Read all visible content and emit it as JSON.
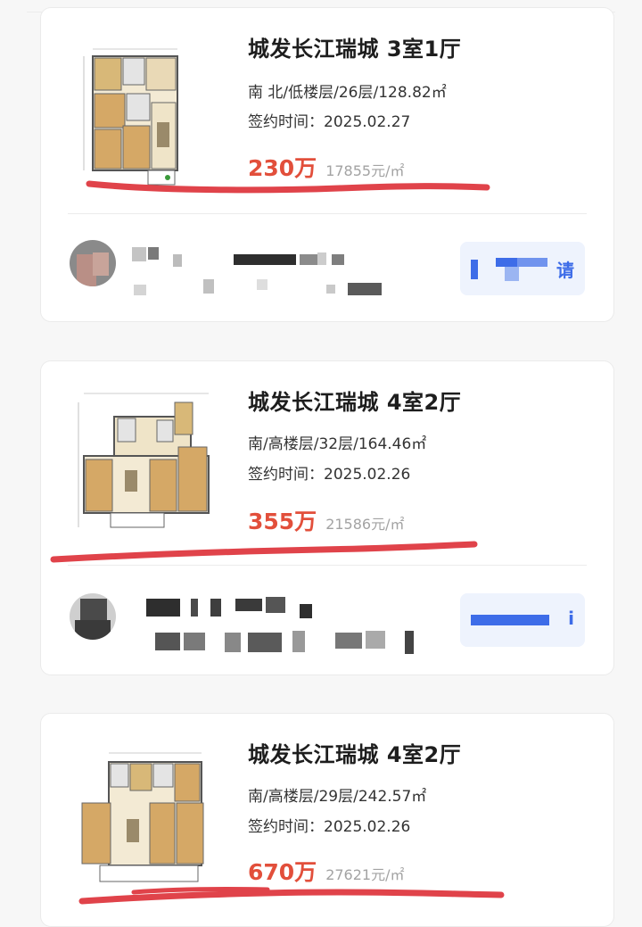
{
  "listings": [
    {
      "title": "城发长江瑞城 3室1厅",
      "details": "南 北/低楼层/26层/128.82㎡",
      "sign_label": "签约时间：",
      "sign_date": "2025.02.27",
      "price": "230万",
      "unit_price": "17855元/㎡",
      "contact_glyph": "请"
    },
    {
      "title": "城发长江瑞城 4室2厅",
      "details": "南/高楼层/32层/164.46㎡",
      "sign_label": "签约时间：",
      "sign_date": "2025.02.26",
      "price": "355万",
      "unit_price": "21586元/㎡",
      "contact_glyph": "i"
    },
    {
      "title": "城发长江瑞城 4室2厅",
      "details": "南/高楼层/29层/242.57㎡",
      "sign_label": "签约时间：",
      "sign_date": "2025.02.26",
      "price": "670万",
      "unit_price": "27621元/㎡"
    }
  ],
  "colors": {
    "price": "#e24f3b",
    "unit_price": "#a3a3a3",
    "title": "#1d1d1d",
    "contact_button_bg": "#eef3fd",
    "contact_button_accent": "#3d6ce8",
    "underline_annotation": "#e0434a"
  }
}
